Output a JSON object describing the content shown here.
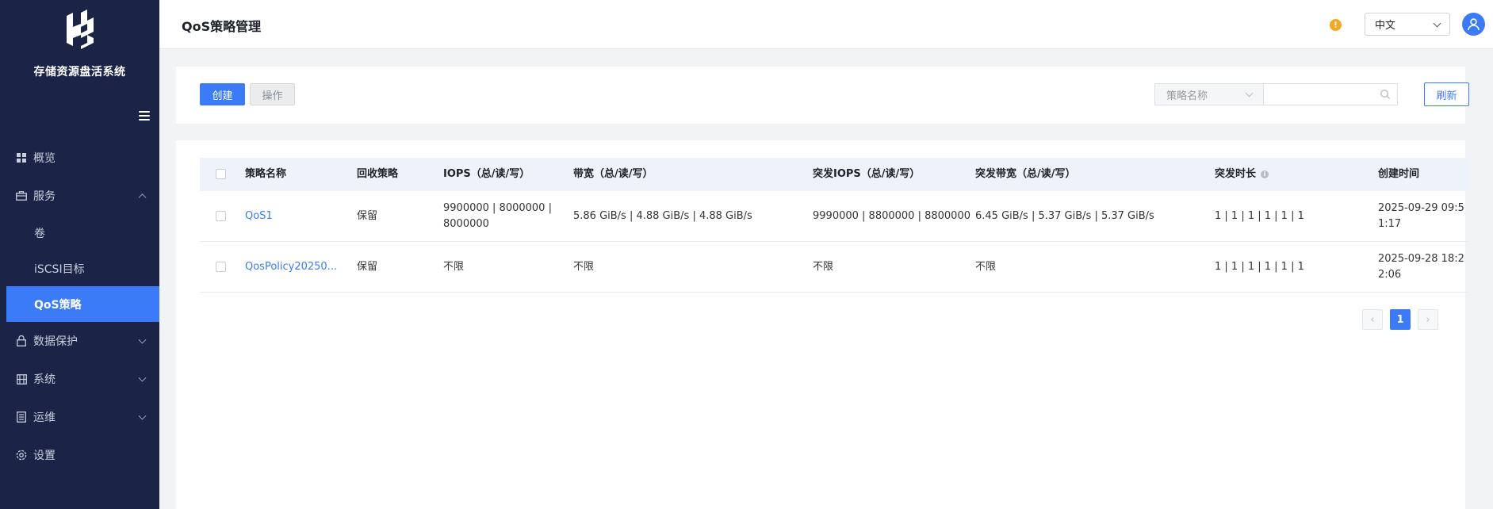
{
  "brand": "存储资源盘活系统",
  "page_title": "QoS策略管理",
  "sidebar": {
    "items": [
      {
        "label": "概览"
      },
      {
        "label": "服务"
      },
      {
        "label": "数据保护"
      },
      {
        "label": "系统"
      },
      {
        "label": "运维"
      },
      {
        "label": "设置"
      }
    ],
    "service_sub": [
      {
        "label": "卷"
      },
      {
        "label": "iSCSI目标"
      },
      {
        "label": "QoS策略",
        "active": true
      }
    ]
  },
  "header": {
    "warning": "!",
    "language": "中文"
  },
  "toolbar": {
    "create_label": "创建",
    "operate_label": "操作",
    "filter_label": "策略名称",
    "search_value": "",
    "refresh_label": "刷新"
  },
  "table": {
    "columns": [
      "策略名称",
      "回收策略",
      "IOPS（总/读/写）",
      "带宽（总/读/写）",
      "突发IOPS（总/读/写）",
      "突发带宽（总/读/写）",
      "突发时长",
      "创建时间"
    ],
    "rows": [
      {
        "name": "QoS1",
        "reclaim": "保留",
        "iops": "9900000 | 8000000 | 8000000",
        "bandwidth": "5.86 GiB/s | 4.88 GiB/s | 4.88 GiB/s",
        "burst_iops": "9990000 | 8800000 | 8800000",
        "burst_bandwidth": "6.45 GiB/s | 5.37 GiB/s | 5.37 GiB/s",
        "burst_duration": "1 | 1 | 1 | 1 | 1 | 1",
        "created": "2025-09-29 09:51:17"
      },
      {
        "name": "QosPolicy20250...",
        "reclaim": "保留",
        "iops": "不限",
        "bandwidth": "不限",
        "burst_iops": "不限",
        "burst_bandwidth": "不限",
        "burst_duration": "1 | 1 | 1 | 1 | 1 | 1",
        "created": "2025-09-28 18:22:06"
      }
    ]
  },
  "pagination": {
    "prev": "‹",
    "current": "1",
    "next": "›"
  },
  "colors": {
    "sidebar_bg": "#1b2446",
    "accent": "#3c7bf7",
    "warning": "#f5a623"
  }
}
